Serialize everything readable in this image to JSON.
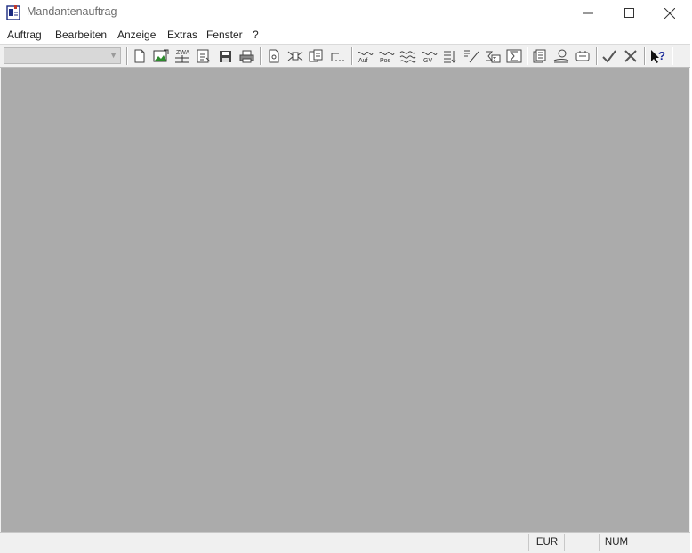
{
  "window": {
    "title": "Mandantenauftrag"
  },
  "menu": [
    {
      "label": "Auftrag"
    },
    {
      "label": "Bearbeiten"
    },
    {
      "label": "Anzeige"
    },
    {
      "label": "Extras"
    },
    {
      "label": "Fenster"
    },
    {
      "label": "?"
    }
  ],
  "toolbar": {
    "combo_value": "",
    "buttons": [
      {
        "name": "new-document-icon"
      },
      {
        "name": "open-image-icon"
      },
      {
        "name": "zwa-icon",
        "text": "ZWA"
      },
      {
        "name": "export-icon"
      },
      {
        "name": "save-icon"
      },
      {
        "name": "print-icon"
      },
      {
        "name": "page-icon"
      },
      {
        "name": "split-icon"
      },
      {
        "name": "copy-icon"
      },
      {
        "name": "line-icon"
      },
      {
        "name": "auf-icon",
        "text": "Auf"
      },
      {
        "name": "pos-icon",
        "text": "Pos"
      },
      {
        "name": "wave-icon"
      },
      {
        "name": "gv-icon",
        "text": "GV"
      },
      {
        "name": "list-sort-icon"
      },
      {
        "name": "pen-icon"
      },
      {
        "name": "sum-box-icon"
      },
      {
        "name": "sum-icon"
      },
      {
        "name": "pages-icon"
      },
      {
        "name": "stamp-icon"
      },
      {
        "name": "device-icon"
      },
      {
        "name": "check-icon"
      },
      {
        "name": "cancel-icon"
      },
      {
        "name": "help-cursor-icon"
      }
    ]
  },
  "status": {
    "currency": "EUR",
    "num": "NUM"
  }
}
